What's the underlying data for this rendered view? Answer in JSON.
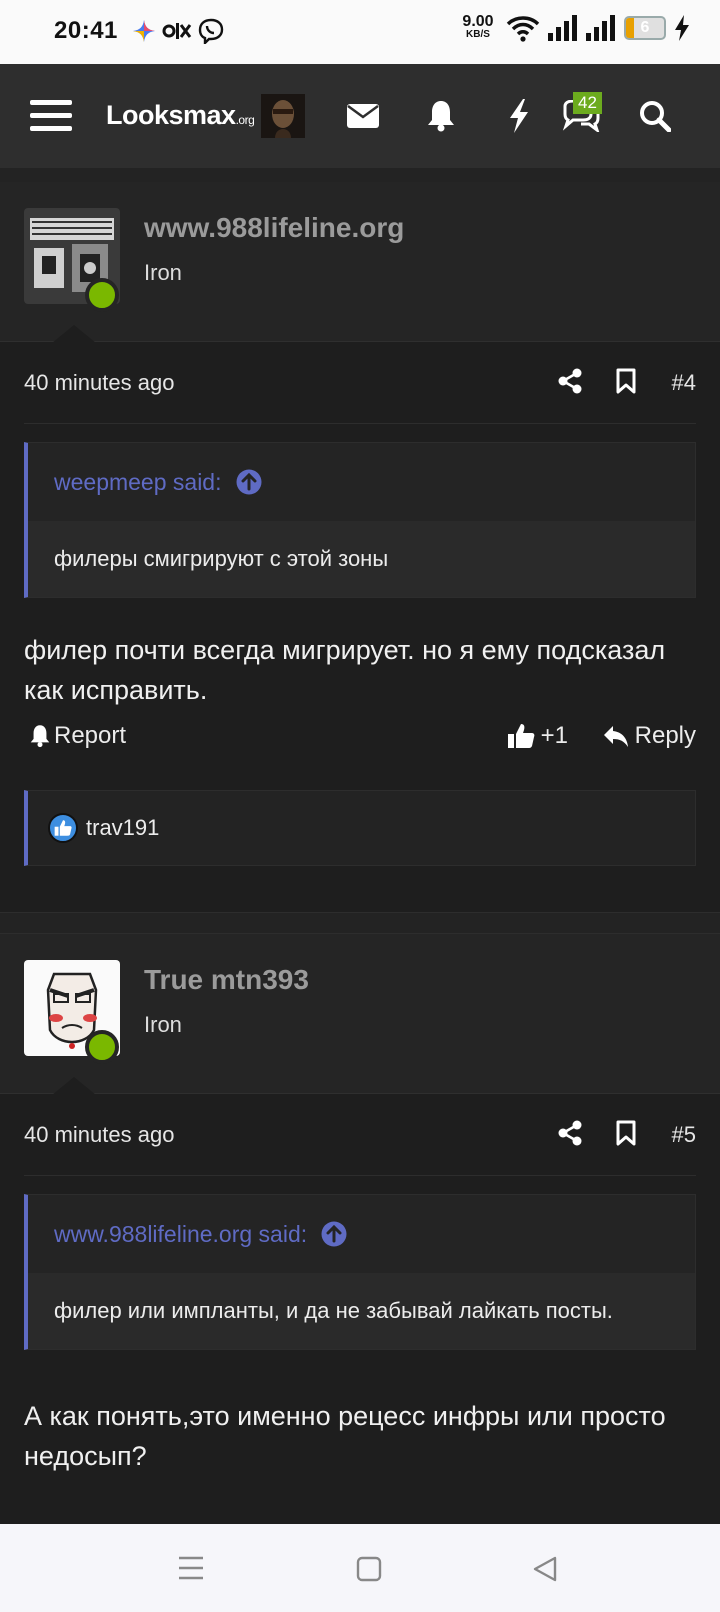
{
  "status": {
    "time": "20:41",
    "net_speed": "9.00",
    "net_unit": "KB/S",
    "battery": "6"
  },
  "header": {
    "logo": "Looksmax",
    "logo_suffix": ".org",
    "alerts_badge": "42"
  },
  "posts": [
    {
      "username": "www.988lifeline.org",
      "user_title": "Iron",
      "time": "40 minutes ago",
      "number": "#4",
      "quote_author": "weepmeep said:",
      "quote_text": "филеры смигрируют с этой зоны",
      "body": "филер почти всегда мигрирует. но я ему подсказал как исправить.",
      "report": "Report",
      "like_count": "+1",
      "reply": "Reply",
      "reaction_user": "trav191"
    },
    {
      "username": "True mtn393",
      "user_title": "Iron",
      "time": "40 minutes ago",
      "number": "#5",
      "quote_author": "www.988lifeline.org said:",
      "quote_text": "филер или импланты, и да не забывай лайкать посты.",
      "body": "А как понять,это именно рецесс инфры или просто недосып?"
    }
  ],
  "colors": {
    "accent": "#5f6bc4",
    "online": "#7ab800",
    "badge": "#6cab1e",
    "background": "#1e1e1e"
  }
}
